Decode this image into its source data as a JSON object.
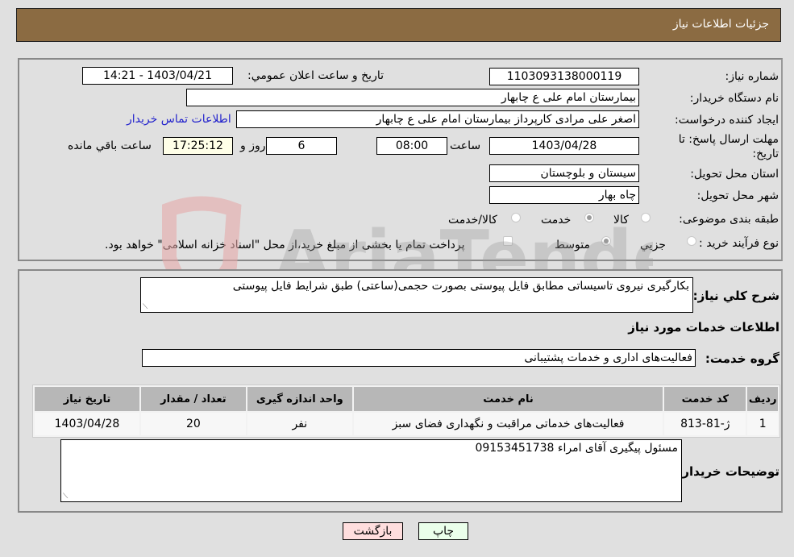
{
  "header": {
    "title": "جزئیات اطلاعات نیاز"
  },
  "form": {
    "need_number_label": "شماره نیاز:",
    "need_number": "1103093138000119",
    "announce_label": "تاریخ و ساعت اعلان عمومي:",
    "announce_value": "1403/04/21 - 14:21",
    "buyer_org_label": "نام دستگاه خریدار:",
    "buyer_org": "بیمارستان امام علی  ع  چابهار",
    "creator_label": "ایجاد کننده درخواست:",
    "creator": "اصغر علی مرادی کارپرداز بیمارستان امام علی  ع  چابهار",
    "buyer_contact_link": "اطلاعات تماس خریدار",
    "deadline_label": "مهلت ارسال پاسخ: تا تاریخ:",
    "deadline_date": "1403/04/28",
    "time_label": "ساعت",
    "deadline_time": "08:00",
    "days": "6",
    "days_label": "روز و",
    "remaining_time": "17:25:12",
    "remaining_label": "ساعت باقي مانده",
    "province_label": "استان محل تحویل:",
    "province": "سیستان و بلوچستان",
    "city_label": "شهر محل تحویل:",
    "city": "چاه بهار",
    "category_label": "طبقه بندی موضوعی:",
    "category_options": [
      "کالا",
      "خدمت",
      "کالا/خدمت"
    ],
    "category_selected": "خدمت",
    "process_label": "نوع فرآیند خرید :",
    "process_options": [
      "جزيي",
      "متوسط"
    ],
    "process_selected": "متوسط",
    "treasury_note": "پرداخت تمام یا بخشی از مبلغ خرید،از محل \"اسناد خزانه اسلامی\" خواهد بود."
  },
  "details": {
    "summary_label": "شرح کلي نياز:",
    "summary": "بکارگیری نیروی تاسیساتی مطابق فایل پیوستی بصورت حجمی(ساعتی) طبق شرایط فایل پیوستی",
    "services_heading": "اطلاعات خدمات مورد نیاز",
    "service_group_label": "گروه خدمت:",
    "service_group": "فعالیت‌های اداری و خدمات پشتیبانی",
    "table": {
      "headers": [
        "ردیف",
        "کد خدمت",
        "نام خدمت",
        "واحد اندازه گیری",
        "تعداد / مقدار",
        "تاریخ نیاز"
      ],
      "rows": [
        [
          "1",
          "ژ-81-813",
          "فعالیت‌های خدماتی مراقبت و نگهداری فضای سبز",
          "نفر",
          "20",
          "1403/04/28"
        ]
      ]
    },
    "buyer_notes_label": "توضیحات خریدار:",
    "buyer_notes": "مسئول پیگیری آقای امراء 09153451738"
  },
  "buttons": {
    "print": "چاپ",
    "back": "بازگشت"
  },
  "colors": {
    "header_bg": "#8b6b42",
    "print_bg": "#eaffea",
    "back_bg": "#ffdede",
    "link": "#2222cc"
  },
  "watermark": "AriaTender.neT"
}
